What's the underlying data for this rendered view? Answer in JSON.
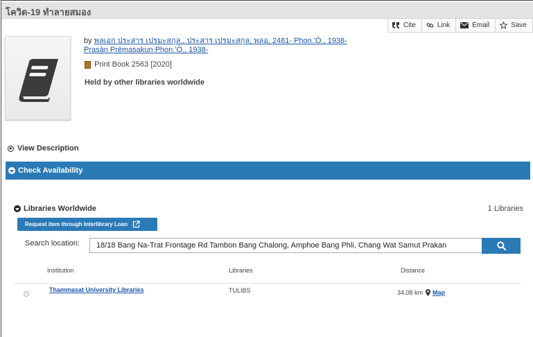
{
  "title": "โควิด-19 ทำลายสมอง",
  "actions": [
    {
      "label": "Cite",
      "icon": "quote-icon"
    },
    {
      "label": "Link",
      "icon": "link-icon"
    },
    {
      "label": "Email",
      "icon": "envelope-icon"
    },
    {
      "label": "Save",
      "icon": "star-icon"
    }
  ],
  "record": {
    "by_prefix": "by ",
    "author_line1": "พลเอก ประสาร เปรมะสกุล., ประสาร เปรมะสกุล, พลอ, 2481- Phon.'Ō., 1938-",
    "author_line2": "Prasān Prēmasakun Phon.'Ō., 1938-",
    "format": "Print Book 2563 [2020]",
    "held": "Held by other libraries worldwide"
  },
  "view_description": "View Description",
  "check_availability": "Check Availability",
  "libraries": {
    "heading": "Libraries Worldwide",
    "count": "1 Libraries",
    "ill_button": "Request item through Interlibrary Loan",
    "search_label": "Search location:",
    "search_value": "18/18 Bang Na-Trat Frontage Rd Tambon Bang Chalong, Amphoe Bang Phli, Chang Wat Samut Prakan",
    "columns": [
      "Institution",
      "Libraries",
      "Distance"
    ],
    "rows": [
      {
        "institution": "Thammasat University Libraries",
        "code": "TULIBS",
        "distance": "34.08 km",
        "map": "Map"
      }
    ]
  },
  "colors": {
    "accent": "#2b7ab6",
    "link": "#1a55a8",
    "title_bar": "#e4e4e4"
  }
}
